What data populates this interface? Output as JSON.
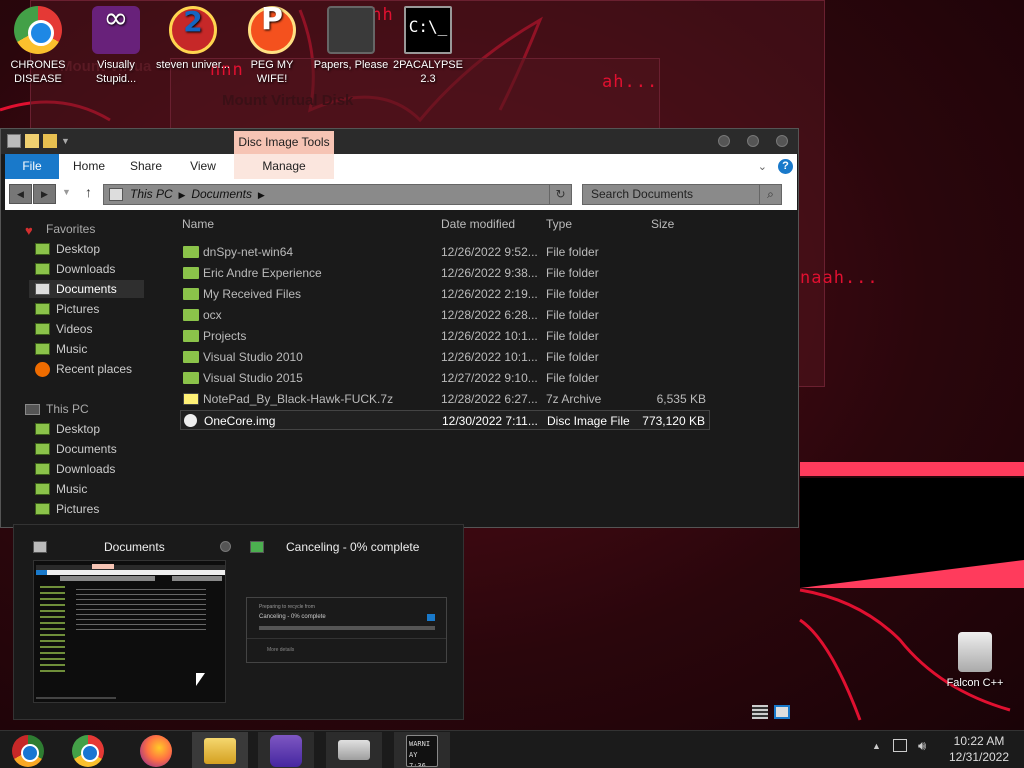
{
  "desktop": {
    "icons": [
      {
        "label": "CHRONES DISEASE",
        "icon": "chrome-icon"
      },
      {
        "label": "Visually Stupid...",
        "icon": "visual-studio-icon"
      },
      {
        "label": "steven univer...",
        "icon": "steven-universe-icon"
      },
      {
        "label": "PEG MY WIFE!",
        "icon": "peggle-icon"
      },
      {
        "label": "Papers, Please",
        "icon": "papers-please-icon"
      },
      {
        "label": "2PACALYPSE 2.3",
        "icon": "cmd-icon"
      },
      {
        "label": "Falcon C++",
        "icon": "recycle-bin-icon"
      }
    ],
    "wallpaper_texts": [
      "ahh",
      "ah...",
      "naah...",
      "nnn"
    ],
    "ghost_windows": {
      "mount_title": "Mount Virtual Disk",
      "mount_title_back": "Mount Virtua"
    },
    "accent_color": "#e01030"
  },
  "explorer": {
    "context_tab": "Disc Image Tools",
    "ribbon_tabs": [
      "File",
      "Home",
      "Share",
      "View",
      "Manage"
    ],
    "address": {
      "crumbs": [
        "This PC",
        "Documents"
      ]
    },
    "search_placeholder": "Search Documents",
    "nav": {
      "favorites_label": "Favorites",
      "favorites": [
        "Desktop",
        "Downloads",
        "Documents",
        "Pictures",
        "Videos",
        "Music",
        "Recent places"
      ],
      "selected": "Documents",
      "this_pc_label": "This PC",
      "this_pc": [
        "Desktop",
        "Documents",
        "Downloads",
        "Music",
        "Pictures"
      ]
    },
    "columns": {
      "name": "Name",
      "date": "Date modified",
      "type": "Type",
      "size": "Size"
    },
    "files": [
      {
        "name": "dnSpy-net-win64",
        "date": "12/26/2022 9:52...",
        "type": "File folder",
        "size": "",
        "kind": "folder"
      },
      {
        "name": "Eric Andre Experience",
        "date": "12/26/2022 9:38...",
        "type": "File folder",
        "size": "",
        "kind": "folder"
      },
      {
        "name": "My Received Files",
        "date": "12/26/2022 2:19...",
        "type": "File folder",
        "size": "",
        "kind": "folder"
      },
      {
        "name": "ocx",
        "date": "12/28/2022 6:28...",
        "type": "File folder",
        "size": "",
        "kind": "folder"
      },
      {
        "name": "Projects",
        "date": "12/26/2022 10:1...",
        "type": "File folder",
        "size": "",
        "kind": "folder"
      },
      {
        "name": "Visual Studio 2010",
        "date": "12/26/2022 10:1...",
        "type": "File folder",
        "size": "",
        "kind": "folder"
      },
      {
        "name": "Visual Studio 2015",
        "date": "12/27/2022 9:10...",
        "type": "File folder",
        "size": "",
        "kind": "folder"
      },
      {
        "name": "NotePad_By_Black-Hawk-FUCK.7z",
        "date": "12/28/2022 6:27...",
        "type": "7z Archive",
        "size": "6,535 KB",
        "kind": "archive"
      },
      {
        "name": "OneCore.img",
        "date": "12/30/2022 7:11...",
        "type": "Disc Image File",
        "size": "773,120 KB",
        "kind": "disc-image"
      }
    ],
    "selected_file": "OneCore.img"
  },
  "preview": {
    "window1_title": "Documents",
    "window2_title": "Canceling - 0% complete",
    "thumb2_text_1": "Preparing to recycle from",
    "thumb2_text_2": "Canceling - 0% complete",
    "thumb2_text_3": "More details"
  },
  "taskbar": {
    "apps": [
      "chrome-alt",
      "chrome",
      "firefox",
      "file-explorer",
      "messenger",
      "drive-mount",
      "warning-console"
    ],
    "active": "file-explorer",
    "warn_text": "WARNI AY 7:36",
    "time": "10:22 AM",
    "date": "12/31/2022"
  }
}
